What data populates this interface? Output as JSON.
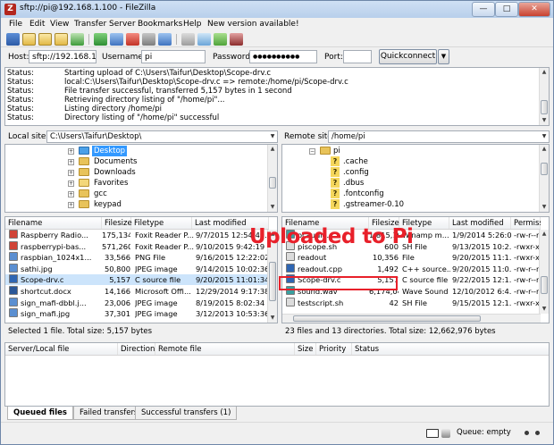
{
  "window": {
    "title": "sftp://pi@192.168.1.100 - FileZilla",
    "app_icon": "Z",
    "minimize_glyph": "—",
    "maximize_glyph": "□",
    "close_glyph": "✕"
  },
  "menu": [
    "File",
    "Edit",
    "View",
    "Transfer",
    "Server",
    "Bookmarks",
    "Help",
    "New version available!"
  ],
  "quickconnect": {
    "host_label": "Host:",
    "host_value": "sftp://192.168.1.100",
    "user_label": "Username:",
    "user_value": "pi",
    "pass_label": "Password:",
    "pass_value": "●●●●●●●●●●",
    "port_label": "Port:",
    "port_value": "",
    "button_label": "Quickconnect",
    "dropdown_glyph": "▼"
  },
  "log": [
    {
      "label": "Status:",
      "text": "Starting upload of C:\\Users\\Taifur\\Desktop\\Scope-drv.c"
    },
    {
      "label": "Status:",
      "text": "local:C:\\Users\\Taifur\\Desktop\\Scope-drv.c => remote:/home/pi/Scope-drv.c"
    },
    {
      "label": "Status:",
      "text": "File transfer successful, transferred 5,157 bytes in 1 second"
    },
    {
      "label": "Status:",
      "text": "Retrieving directory listing of \"/home/pi\"..."
    },
    {
      "label": "Status:",
      "text": "Listing directory /home/pi"
    },
    {
      "label": "Status:",
      "text": "Directory listing of \"/home/pi\" successful"
    }
  ],
  "local": {
    "site_label": "Local site:",
    "site_path": "C:\\Users\\Taifur\\Desktop\\",
    "tree": [
      {
        "name": "Desktop",
        "selected": true
      },
      {
        "name": "Documents"
      },
      {
        "name": "Downloads"
      },
      {
        "name": "Favorites"
      },
      {
        "name": "gcc"
      },
      {
        "name": "keypad"
      }
    ],
    "columns": [
      "Filename",
      "Filesize",
      "Filetype",
      "Last modified"
    ],
    "files": [
      {
        "name": "Raspberry Radio...",
        "size": "175,134",
        "type": "Foxit Reader P...",
        "modified": "9/7/2015 12:54:49...",
        "icon": "pdf-icon"
      },
      {
        "name": "raspberrypi-bas...",
        "size": "571,260",
        "type": "Foxit Reader P...",
        "modified": "9/10/2015 9:42:19 ...",
        "icon": "pdf-icon"
      },
      {
        "name": "raspbian_1024x1...",
        "size": "33,566",
        "type": "PNG File",
        "modified": "9/16/2015 12:22:02...",
        "icon": "image-icon"
      },
      {
        "name": "sathi.jpg",
        "size": "50,800",
        "type": "JPEG image",
        "modified": "9/14/2015 10:02:36...",
        "icon": "image-icon"
      },
      {
        "name": "Scope-drv.c",
        "size": "5,157",
        "type": "C source file",
        "modified": "9/20/2015 11:01:34...",
        "icon": "c-file-icon",
        "selected": true
      },
      {
        "name": "shortcut.docx",
        "size": "14,166",
        "type": "Microsoft Offi...",
        "modified": "12/29/2014 9:17:38...",
        "icon": "doc-icon"
      },
      {
        "name": "sign_mafi-dbbl.j...",
        "size": "23,006",
        "type": "JPEG image",
        "modified": "8/19/2015 8:02:34 ...",
        "icon": "image-icon"
      },
      {
        "name": "sign_mafi.jpg",
        "size": "37,301",
        "type": "JPEG image",
        "modified": "3/12/2013 10:53:36...",
        "icon": "image-icon"
      }
    ],
    "status": "Selected 1 file. Total size: 5,157 bytes"
  },
  "remote": {
    "site_label": "Remote site:",
    "site_path": "/home/pi",
    "tree": [
      {
        "name": "pi",
        "type": "folder"
      },
      {
        "name": ".cache",
        "type": "unknown"
      },
      {
        "name": ".config",
        "type": "unknown"
      },
      {
        "name": ".dbus",
        "type": "unknown"
      },
      {
        "name": ".fontconfig",
        "type": "unknown"
      },
      {
        "name": ".gstreamer-0.10",
        "type": "unknown"
      }
    ],
    "columns": [
      "Filename",
      "Filesize",
      "Filetype",
      "Last modified",
      "Permissi"
    ],
    "files": [
      {
        "name": "ocaudio...",
        "size": "1,815,10",
        "type": "Winamp m...",
        "modified": "1/9/2014 5:26:0...",
        "perms": "-rw-r--r",
        "icon": "audio-icon"
      },
      {
        "name": "piscope.sh",
        "size": "600",
        "type": "SH File",
        "modified": "9/13/2015 10:2...",
        "perms": "-rwxr-xr",
        "icon": "file-icon"
      },
      {
        "name": "readout",
        "size": "10,356",
        "type": "File",
        "modified": "9/20/2015 11:1...",
        "perms": "-rwxr-xr",
        "icon": "file-icon"
      },
      {
        "name": "readout.cpp",
        "size": "1,492",
        "type": "C++ source...",
        "modified": "9/20/2015 11:0...",
        "perms": "-rw-r--r",
        "icon": "c-file-icon"
      },
      {
        "name": "Scope-drv.c",
        "size": "5,157",
        "type": "C source file",
        "modified": "9/22/2015 12:1...",
        "perms": "-rw-r--r",
        "icon": "c-file-icon",
        "highlight": true
      },
      {
        "name": "sound.wav",
        "size": "6,174,044",
        "type": "Wave Sound",
        "modified": "12/10/2012 6:4...",
        "perms": "-rw-r--r",
        "icon": "audio-icon"
      },
      {
        "name": "testscript.sh",
        "size": "42",
        "type": "SH File",
        "modified": "9/15/2015 12:1...",
        "perms": "-rwxr-xr",
        "icon": "file-icon"
      }
    ],
    "status": "23 files and 13 directories. Total size: 12,662,976 bytes"
  },
  "annotation": {
    "text": "Uploaded to Pi",
    "color": "#e8202a"
  },
  "queue": {
    "columns": [
      "Server/Local file",
      "Direction",
      "Remote file",
      "Size",
      "Priority",
      "Status"
    ],
    "tabs": [
      "Queued files",
      "Failed transfers",
      "Successful transfers (1)"
    ],
    "status": "Queue: empty"
  }
}
